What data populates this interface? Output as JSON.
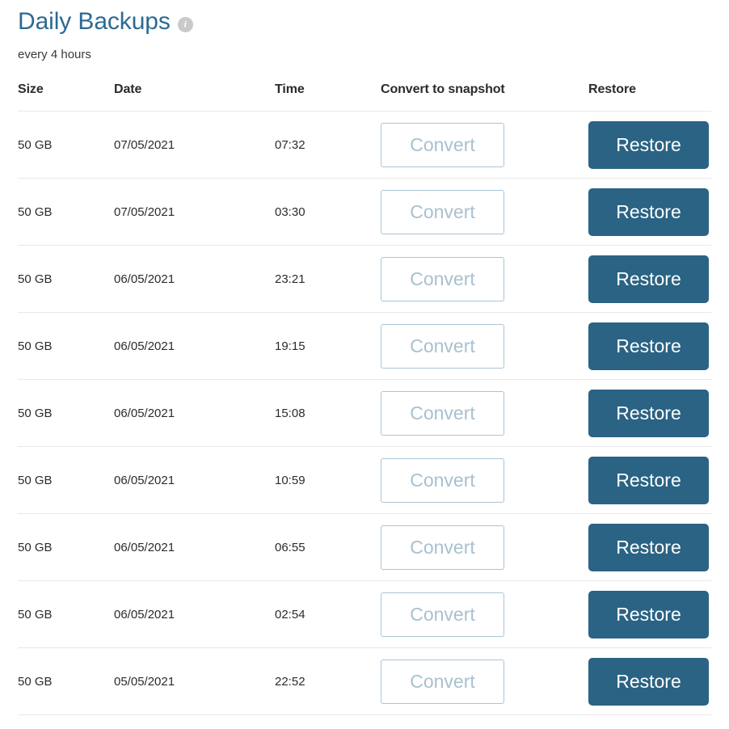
{
  "header": {
    "title": "Daily Backups",
    "info_icon": "info-icon",
    "info_icon_glyph": "i",
    "subtitle": "every 4 hours"
  },
  "colors": {
    "title_blue": "#2d6a92",
    "restore_button_bg": "#2a6384",
    "convert_button_border": "#a9c5d7",
    "convert_button_text": "#a9c0cf",
    "row_divider": "#e8e8e8",
    "info_icon_bg": "#c9c9c9",
    "body_text": "#2b2b2b"
  },
  "table": {
    "columns": [
      {
        "key": "size",
        "label": "Size"
      },
      {
        "key": "date",
        "label": "Date"
      },
      {
        "key": "time",
        "label": "Time"
      },
      {
        "key": "convert",
        "label": "Convert to snapshot"
      },
      {
        "key": "restore",
        "label": "Restore"
      }
    ],
    "convert_label": "Convert",
    "restore_label": "Restore",
    "rows": [
      {
        "size": "50 GB",
        "date": "07/05/2021",
        "time": "07:32",
        "convert": "Convert",
        "restore": "Restore"
      },
      {
        "size": "50 GB",
        "date": "07/05/2021",
        "time": "03:30",
        "convert": "Convert",
        "restore": "Restore"
      },
      {
        "size": "50 GB",
        "date": "06/05/2021",
        "time": "23:21",
        "convert": "Convert",
        "restore": "Restore"
      },
      {
        "size": "50 GB",
        "date": "06/05/2021",
        "time": "19:15",
        "convert": "Convert",
        "restore": "Restore"
      },
      {
        "size": "50 GB",
        "date": "06/05/2021",
        "time": "15:08",
        "convert": "Convert",
        "restore": "Restore"
      },
      {
        "size": "50 GB",
        "date": "06/05/2021",
        "time": "10:59",
        "convert": "Convert",
        "restore": "Restore"
      },
      {
        "size": "50 GB",
        "date": "06/05/2021",
        "time": "06:55",
        "convert": "Convert",
        "restore": "Restore"
      },
      {
        "size": "50 GB",
        "date": "06/05/2021",
        "time": "02:54",
        "convert": "Convert",
        "restore": "Restore"
      },
      {
        "size": "50 GB",
        "date": "05/05/2021",
        "time": "22:52",
        "convert": "Convert",
        "restore": "Restore"
      }
    ]
  }
}
